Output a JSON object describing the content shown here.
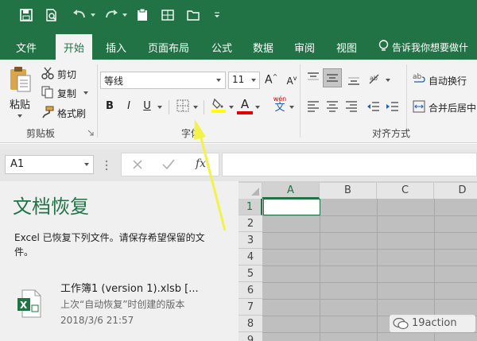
{
  "quick_access": {
    "undo_icon": "undo-icon",
    "redo_icon": "redo-icon"
  },
  "menu": {
    "file": "文件",
    "home": "开始",
    "insert": "插入",
    "page_layout": "页面布局",
    "formulas": "公式",
    "data": "数据",
    "review": "审阅",
    "view": "视图",
    "tell_me": "告诉我你想要做什"
  },
  "clipboard": {
    "paste": "粘贴",
    "cut": "剪切",
    "copy": "复制",
    "format_painter": "格式刷",
    "group_label": "剪贴板"
  },
  "font": {
    "name": "等线",
    "size": "11",
    "bold": "B",
    "italic": "I",
    "underline": "U",
    "grow": "A",
    "shrink": "A",
    "font_color_letter": "A",
    "wen": "文",
    "wen_top": "wén",
    "group_label": "字体"
  },
  "alignment": {
    "wrap_text": "自动换行",
    "merge_center": "合并后居中",
    "group_label": "对齐方式"
  },
  "formula_bar": {
    "name_box": "A1",
    "fx": "fx",
    "value": ""
  },
  "recovery": {
    "title": "文档恢复",
    "message_line1": "Excel 已恢复下列文件。请保存希望保留的文",
    "message_line2": "件。",
    "file_name": "工作簿1 (version 1).xlsb  [...",
    "file_desc": "上次“自动恢复”时创建的版本",
    "file_date": "2018/3/6 21:57"
  },
  "sheet": {
    "columns": [
      "A",
      "B",
      "C",
      "D"
    ],
    "rows": [
      "1",
      "2",
      "3",
      "4",
      "5",
      "6",
      "7",
      "8",
      "9"
    ]
  },
  "watermark": {
    "text": "19action"
  },
  "colors": {
    "excel_green": "#217346",
    "highlight_yellow": "#ffff00",
    "font_red": "#e00000",
    "annotation_arrow": "#f2f24a"
  }
}
